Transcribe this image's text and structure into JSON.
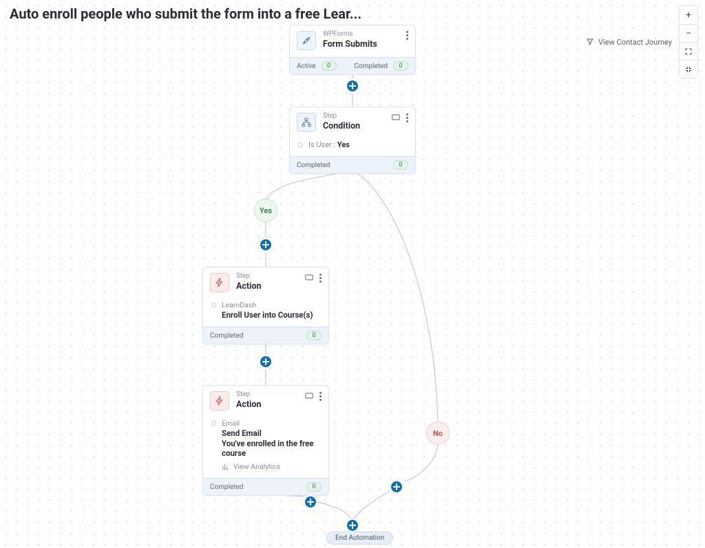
{
  "page_title": "Auto enroll people who submit the form into a free Lear...",
  "toolbar": {
    "view_contact_journey": "View Contact Journey"
  },
  "labels": {
    "active": "Active",
    "completed": "Completed",
    "step": "Step",
    "end_automation": "End Automation",
    "view_analytics": "View Analytics"
  },
  "branches": {
    "yes": "Yes",
    "no": "No"
  },
  "nodes": {
    "trigger": {
      "integration": "WPForms",
      "title": "Form Submits",
      "active_count": "0",
      "completed_count": "0"
    },
    "condition": {
      "title": "Condition",
      "rule_key": "Is User :",
      "rule_value": "Yes",
      "completed_count": "0"
    },
    "action1": {
      "title": "Action",
      "integration": "LearnDash",
      "description": "Enroll User into Course(s)",
      "completed_count": "0"
    },
    "action2": {
      "title": "Action",
      "integration": "Email",
      "description": "Send Email",
      "subject": "You've enrolled in the free course",
      "completed_count": "0"
    }
  }
}
